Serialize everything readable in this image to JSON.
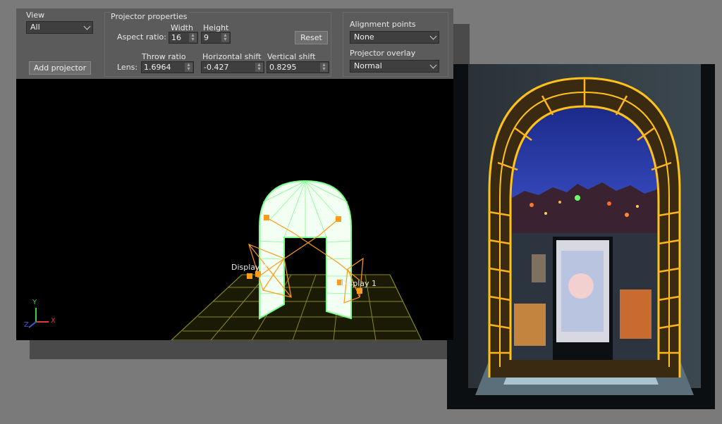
{
  "toolbar": {
    "view_label": "View",
    "view_value": "All",
    "add_projector": "Add projector",
    "props_title": "Projector properties",
    "aspect_label": "Aspect ratio:",
    "width_label": "Width",
    "height_label": "Height",
    "width_value": "16",
    "height_value": "9",
    "reset": "Reset",
    "lens_label": "Lens:",
    "throw_label": "Throw ratio",
    "throw_value": "1.6964",
    "hshift_label": "Horizontal shift",
    "hshift_value": "-0.427",
    "vshift_label": "Vertical shift",
    "vshift_value": "0.8295",
    "align_label": "Alignment points",
    "align_value": "None",
    "overlay_label": "Projector overlay",
    "overlay_value": "Normal"
  },
  "viewport": {
    "display2": "Display 2",
    "display1": "Display 1",
    "axis_x": "X",
    "axis_y": "Y",
    "axis_z": "Z"
  },
  "colors": {
    "toolbar_bg": "#5b5b5b",
    "model_green": "#7dff8c",
    "frustum_orange": "#ff9a1a",
    "grid_yellow": "#8a8a20"
  }
}
